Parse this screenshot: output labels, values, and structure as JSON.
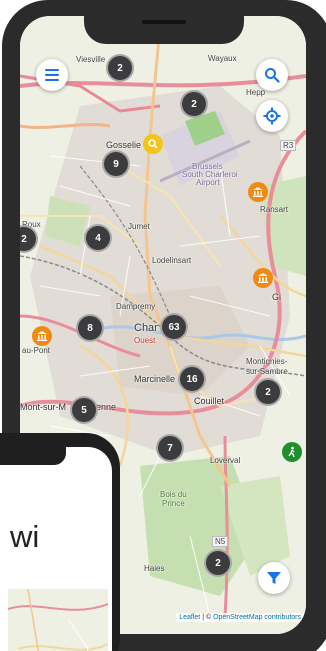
{
  "map": {
    "labels": {
      "viesville": "Viesville",
      "wayaux": "Wayaux",
      "gosselies": "Gosselie",
      "airport_line1": "Brussels",
      "airport_line2": "South Charleroi",
      "airport_line3": "Airport",
      "ransart": "Ransart",
      "jumet": "Jumet",
      "roux": "Roux",
      "lodelinsart": "Lodelinsart",
      "dampremy": "Dampremy",
      "charleroi": "Char",
      "gilly": "Gi",
      "au_pont": "au-Pont",
      "montignies": "Montignies-",
      "sur_sambre": "sur-Sambre",
      "marcinelle": "Marcinelle",
      "couillet": "Couillet",
      "mont_sur": "Mont-sur-M",
      "enne": "enne",
      "loverval": "Loverval",
      "bois": "Bois du",
      "prince": "Prince",
      "haies": "Haies",
      "route_n5": "N5",
      "route_r3": "R3",
      "ouest": "Ouest",
      "heppignies": "Hepp"
    },
    "clusters": [
      {
        "id": "c1",
        "count": "2"
      },
      {
        "id": "c2",
        "count": "2"
      },
      {
        "id": "c3",
        "count": "9"
      },
      {
        "id": "c4",
        "count": "2"
      },
      {
        "id": "c5",
        "count": "4"
      },
      {
        "id": "c6",
        "count": "8"
      },
      {
        "id": "c7",
        "count": "63"
      },
      {
        "id": "c8",
        "count": "16"
      },
      {
        "id": "c9",
        "count": "2"
      },
      {
        "id": "c10",
        "count": "5"
      },
      {
        "id": "c11",
        "count": "7"
      },
      {
        "id": "c12",
        "count": "2"
      }
    ],
    "attribution": {
      "leaflet": "Leaflet",
      "separator": " | © ",
      "osm": "OpenStreetMap contributors"
    }
  },
  "controls": {
    "menu_icon": "hamburger-menu-icon",
    "search_icon": "search-icon",
    "locate_icon": "crosshair-locate-icon",
    "filter_icon": "filter-funnel-icon"
  },
  "overlay_phone": {
    "heading_fragment": "wi"
  },
  "colors": {
    "cluster": "#3c3c3e",
    "poi_orange": "#f08a12",
    "poi_yellow": "#f3c51b",
    "poi_green": "#1f8f2e",
    "accent_blue": "#1a73e8",
    "phone_frame": "#2b2b2b"
  }
}
